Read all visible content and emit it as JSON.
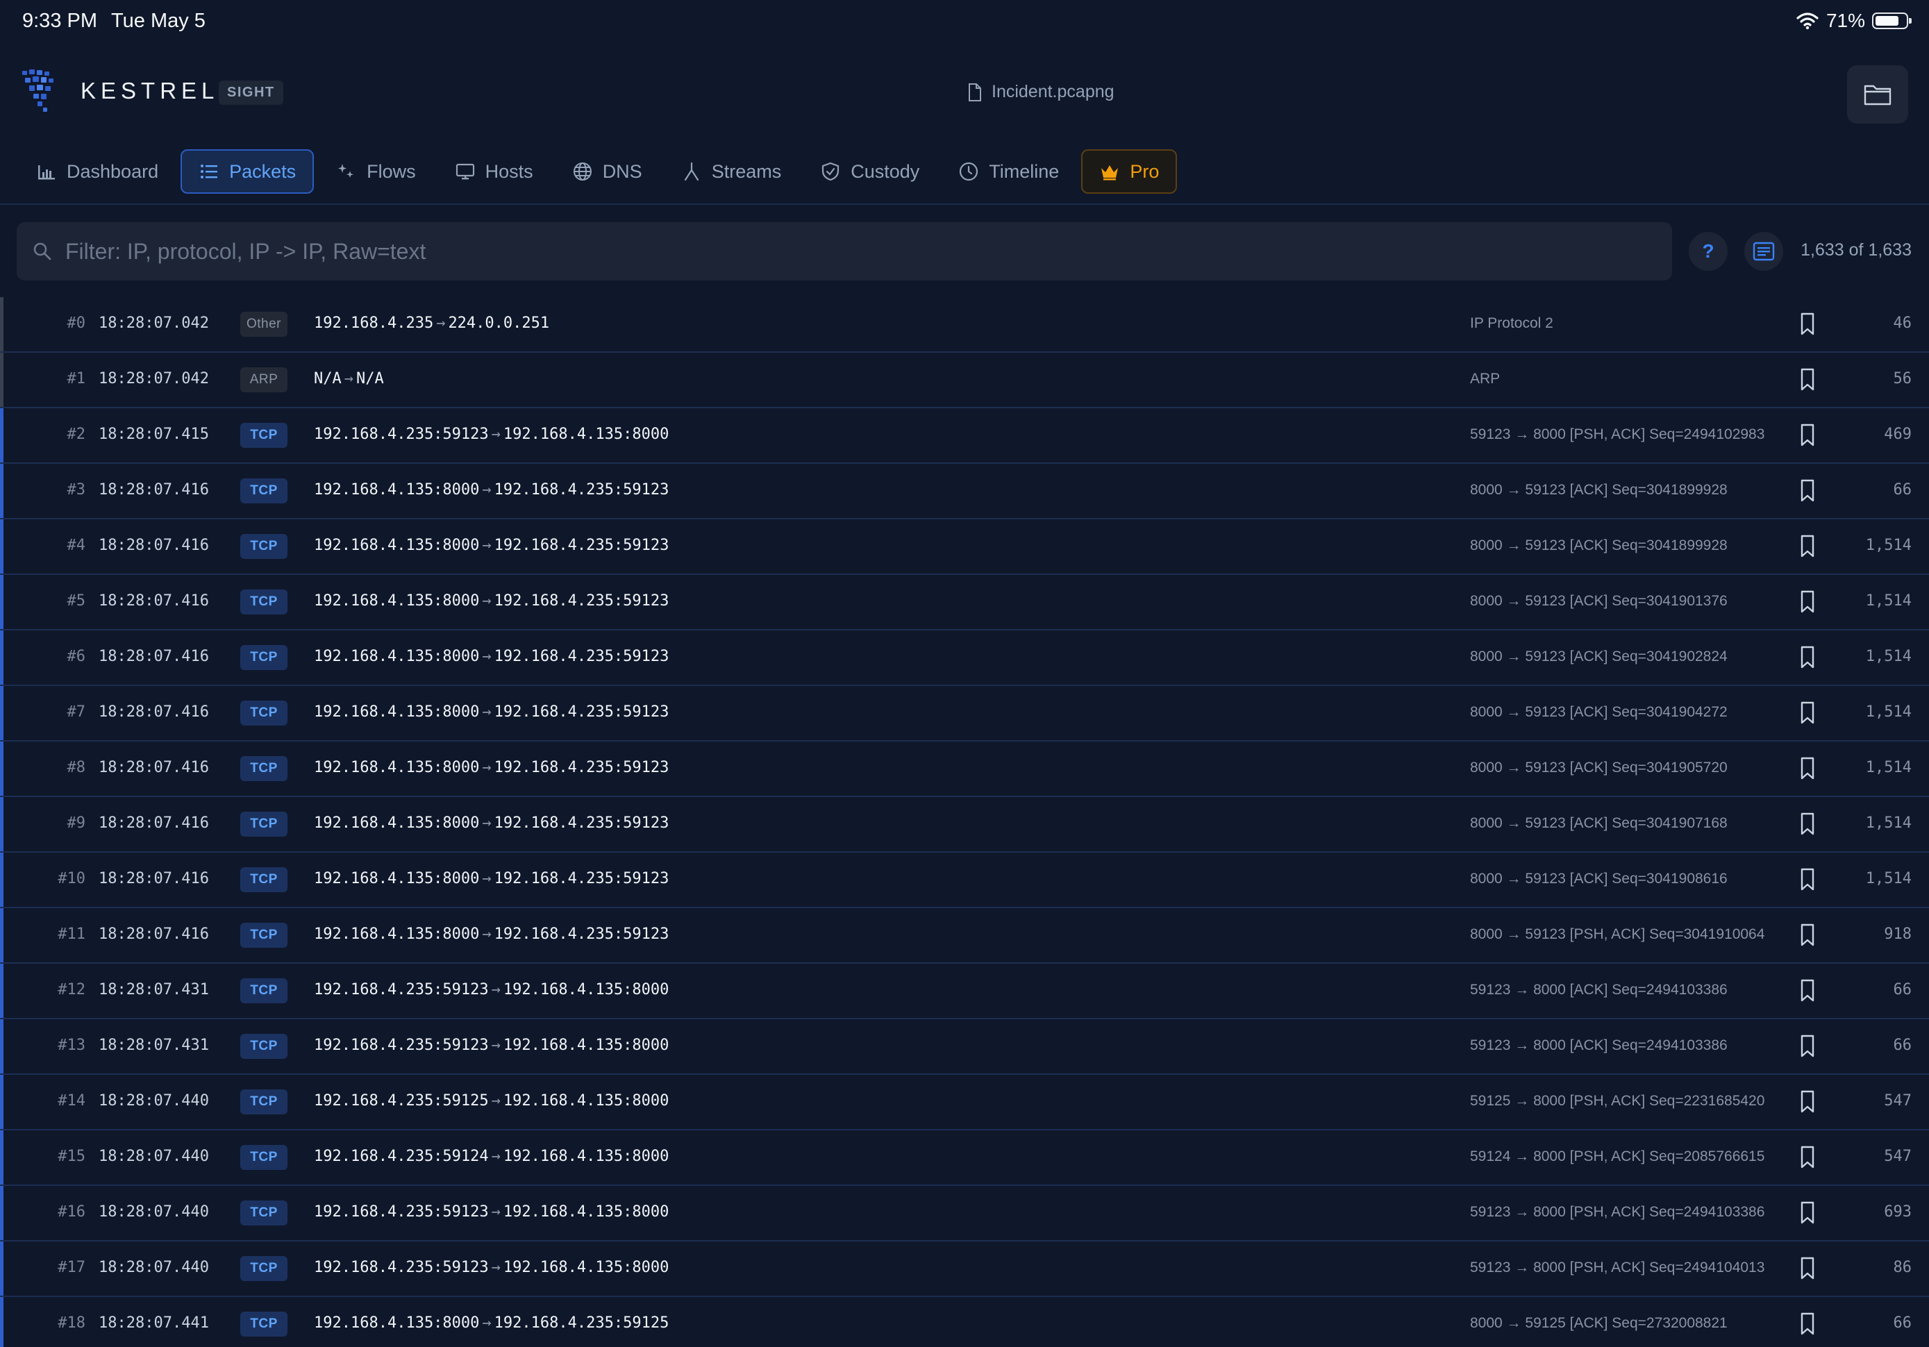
{
  "status_bar": {
    "time": "9:33 PM",
    "date": "Tue May 5",
    "battery": "71%"
  },
  "header": {
    "brand": "KESTREL",
    "edition": "SIGHT",
    "filename": "Incident.pcapng"
  },
  "tabs": [
    {
      "label": "Dashboard",
      "icon": "bar-chart-icon"
    },
    {
      "label": "Packets",
      "icon": "list-icon",
      "active": true
    },
    {
      "label": "Flows",
      "icon": "sparkle-icon"
    },
    {
      "label": "Hosts",
      "icon": "monitor-icon"
    },
    {
      "label": "DNS",
      "icon": "globe-icon"
    },
    {
      "label": "Streams",
      "icon": "fork-icon"
    },
    {
      "label": "Custody",
      "icon": "shield-check-icon"
    },
    {
      "label": "Timeline",
      "icon": "clock-icon"
    },
    {
      "label": "Pro",
      "icon": "crown-icon",
      "accent": "#f59e0b"
    }
  ],
  "filter": {
    "placeholder": "Filter: IP, protocol, IP -> IP, Raw=text",
    "value": ""
  },
  "help_label": "?",
  "packet_count": "1,633 of 1,633",
  "colors": {
    "background": "#0f172a",
    "accent_blue": "#3b82f6",
    "pro_gold": "#f59e0b",
    "tcp_badge": "#1b3260"
  },
  "packets": [
    {
      "num": "#0",
      "time": "18:28:07.042",
      "proto": "Other",
      "src": "192.168.4.235",
      "dst": "224.0.0.251",
      "info": "IP Protocol 2",
      "len": "46"
    },
    {
      "num": "#1",
      "time": "18:28:07.042",
      "proto": "ARP",
      "src": "N/A",
      "dst": "N/A",
      "info": "ARP",
      "len": "56"
    },
    {
      "num": "#2",
      "time": "18:28:07.415",
      "proto": "TCP",
      "src": "192.168.4.235:59123",
      "dst": "192.168.4.135:8000",
      "info": "59123 → 8000 [PSH, ACK] Seq=2494102983",
      "len": "469"
    },
    {
      "num": "#3",
      "time": "18:28:07.416",
      "proto": "TCP",
      "src": "192.168.4.135:8000",
      "dst": "192.168.4.235:59123",
      "info": "8000 → 59123 [ACK] Seq=3041899928",
      "len": "66"
    },
    {
      "num": "#4",
      "time": "18:28:07.416",
      "proto": "TCP",
      "src": "192.168.4.135:8000",
      "dst": "192.168.4.235:59123",
      "info": "8000 → 59123 [ACK] Seq=3041899928",
      "len": "1,514"
    },
    {
      "num": "#5",
      "time": "18:28:07.416",
      "proto": "TCP",
      "src": "192.168.4.135:8000",
      "dst": "192.168.4.235:59123",
      "info": "8000 → 59123 [ACK] Seq=3041901376",
      "len": "1,514"
    },
    {
      "num": "#6",
      "time": "18:28:07.416",
      "proto": "TCP",
      "src": "192.168.4.135:8000",
      "dst": "192.168.4.235:59123",
      "info": "8000 → 59123 [ACK] Seq=3041902824",
      "len": "1,514"
    },
    {
      "num": "#7",
      "time": "18:28:07.416",
      "proto": "TCP",
      "src": "192.168.4.135:8000",
      "dst": "192.168.4.235:59123",
      "info": "8000 → 59123 [ACK] Seq=3041904272",
      "len": "1,514"
    },
    {
      "num": "#8",
      "time": "18:28:07.416",
      "proto": "TCP",
      "src": "192.168.4.135:8000",
      "dst": "192.168.4.235:59123",
      "info": "8000 → 59123 [ACK] Seq=3041905720",
      "len": "1,514"
    },
    {
      "num": "#9",
      "time": "18:28:07.416",
      "proto": "TCP",
      "src": "192.168.4.135:8000",
      "dst": "192.168.4.235:59123",
      "info": "8000 → 59123 [ACK] Seq=3041907168",
      "len": "1,514"
    },
    {
      "num": "#10",
      "time": "18:28:07.416",
      "proto": "TCP",
      "src": "192.168.4.135:8000",
      "dst": "192.168.4.235:59123",
      "info": "8000 → 59123 [ACK] Seq=3041908616",
      "len": "1,514"
    },
    {
      "num": "#11",
      "time": "18:28:07.416",
      "proto": "TCP",
      "src": "192.168.4.135:8000",
      "dst": "192.168.4.235:59123",
      "info": "8000 → 59123 [PSH, ACK] Seq=3041910064",
      "len": "918"
    },
    {
      "num": "#12",
      "time": "18:28:07.431",
      "proto": "TCP",
      "src": "192.168.4.235:59123",
      "dst": "192.168.4.135:8000",
      "info": "59123 → 8000 [ACK] Seq=2494103386",
      "len": "66"
    },
    {
      "num": "#13",
      "time": "18:28:07.431",
      "proto": "TCP",
      "src": "192.168.4.235:59123",
      "dst": "192.168.4.135:8000",
      "info": "59123 → 8000 [ACK] Seq=2494103386",
      "len": "66"
    },
    {
      "num": "#14",
      "time": "18:28:07.440",
      "proto": "TCP",
      "src": "192.168.4.235:59125",
      "dst": "192.168.4.135:8000",
      "info": "59125 → 8000 [PSH, ACK] Seq=2231685420",
      "len": "547"
    },
    {
      "num": "#15",
      "time": "18:28:07.440",
      "proto": "TCP",
      "src": "192.168.4.235:59124",
      "dst": "192.168.4.135:8000",
      "info": "59124 → 8000 [PSH, ACK] Seq=2085766615",
      "len": "547"
    },
    {
      "num": "#16",
      "time": "18:28:07.440",
      "proto": "TCP",
      "src": "192.168.4.235:59123",
      "dst": "192.168.4.135:8000",
      "info": "59123 → 8000 [PSH, ACK] Seq=2494103386",
      "len": "693"
    },
    {
      "num": "#17",
      "time": "18:28:07.440",
      "proto": "TCP",
      "src": "192.168.4.235:59123",
      "dst": "192.168.4.135:8000",
      "info": "59123 → 8000 [PSH, ACK] Seq=2494104013",
      "len": "86"
    },
    {
      "num": "#18",
      "time": "18:28:07.441",
      "proto": "TCP",
      "src": "192.168.4.135:8000",
      "dst": "192.168.4.235:59125",
      "info": "8000 → 59125 [ACK] Seq=2732008821",
      "len": "66"
    }
  ]
}
